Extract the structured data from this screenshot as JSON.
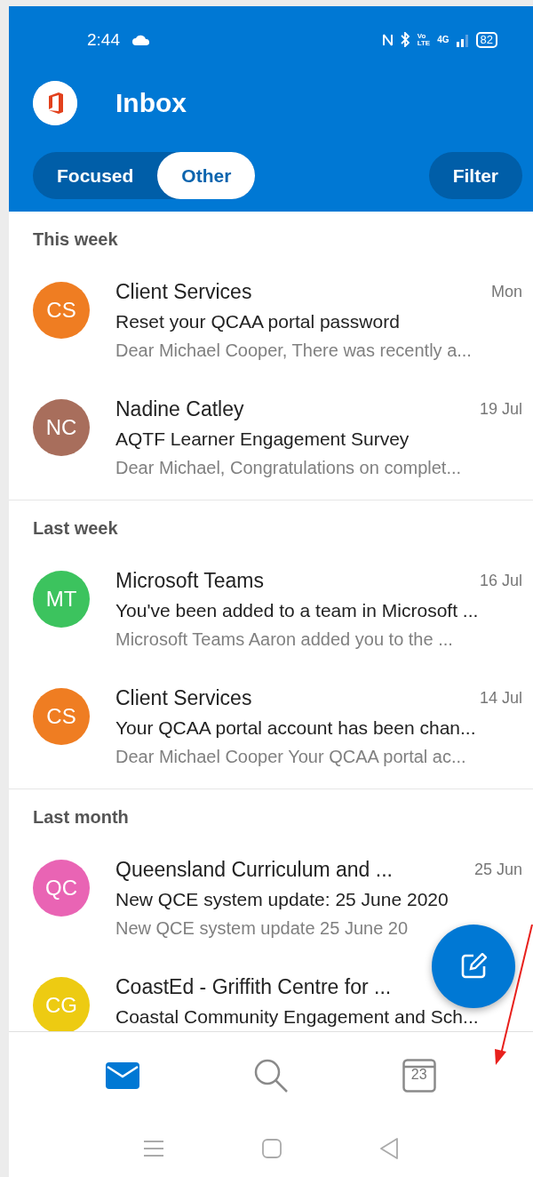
{
  "status_bar": {
    "time": "2:44",
    "volte": [
      "Vo",
      "LTE"
    ],
    "network": "4G",
    "battery": "82"
  },
  "header": {
    "title": "Inbox"
  },
  "tabs": [
    {
      "label": "Focused",
      "selected": false
    },
    {
      "label": "Other",
      "selected": true
    }
  ],
  "filter_button": "Filter",
  "sections": [
    {
      "title": "This week",
      "messages": [
        {
          "initials": "CS",
          "color": "#ef7d22",
          "sender": "Client Services",
          "date": "Mon",
          "subject": "Reset your QCAA portal password",
          "preview": "Dear Michael Cooper, There was recently a..."
        },
        {
          "initials": "NC",
          "color": "#a86e5c",
          "sender": "Nadine Catley",
          "date": "19 Jul",
          "subject": "AQTF Learner Engagement Survey",
          "preview": "Dear Michael, Congratulations on complet..."
        }
      ]
    },
    {
      "title": "Last week",
      "messages": [
        {
          "initials": "MT",
          "color": "#3cc35e",
          "sender": "Microsoft Teams",
          "date": "16 Jul",
          "subject": "You've been added to a team in Microsoft ...",
          "preview": "Microsoft Teams Aaron added you to the ..."
        },
        {
          "initials": "CS",
          "color": "#ef7d22",
          "sender": "Client Services",
          "date": "14 Jul",
          "subject": "Your QCAA portal account has been chan...",
          "preview": "Dear Michael Cooper Your QCAA portal ac..."
        }
      ]
    },
    {
      "title": "Last month",
      "messages": [
        {
          "initials": "QC",
          "color": "#e964b4",
          "sender": "Queensland Curriculum and ...",
          "date": "25 Jun",
          "subject": "New QCE system update: 25 June 2020",
          "preview": "New QCE system update 25 June 20"
        },
        {
          "initials": "CG",
          "color": "#edcb12",
          "sender": "CoastEd - Griffith Centre for ...",
          "subject": "Coastal Community Engagement and Sch..."
        }
      ]
    }
  ],
  "bottom_nav": [
    {
      "kind": "mail",
      "selected": true
    },
    {
      "kind": "search",
      "selected": false
    },
    {
      "kind": "calendar",
      "selected": false,
      "date": "23"
    }
  ]
}
